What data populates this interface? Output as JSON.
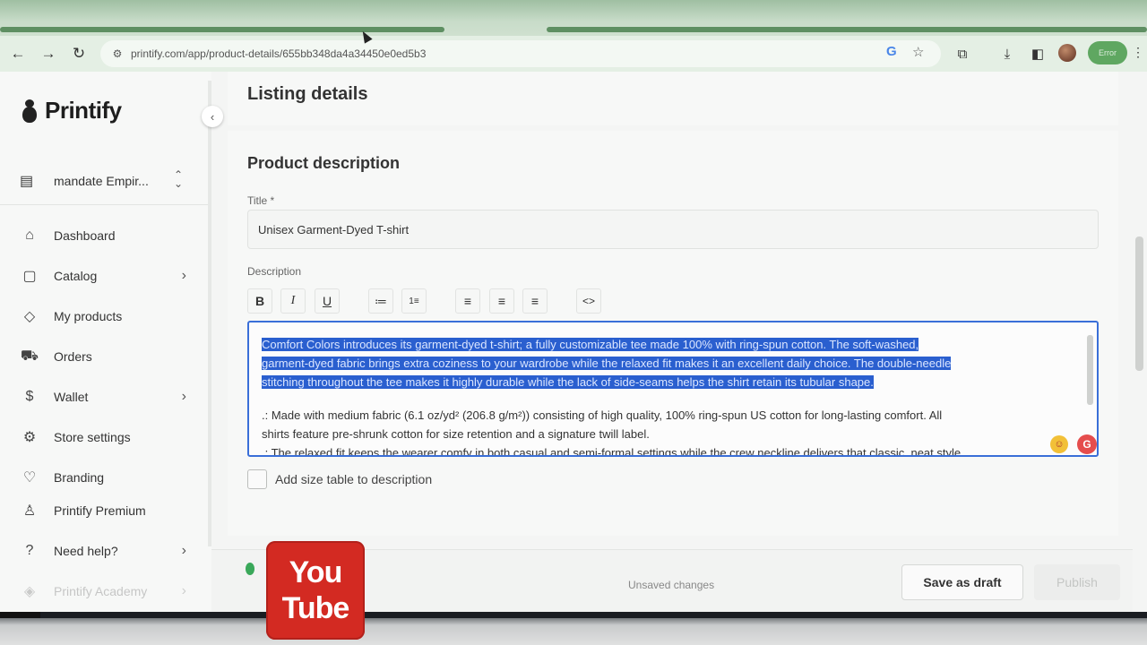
{
  "browser": {
    "url": "printify.com/app/product-details/655bb348da4a34450e0ed5b3",
    "profile_chip": "Error",
    "icons": [
      "back-icon",
      "forward-icon",
      "reload-icon",
      "site-info-icon",
      "google-icon",
      "star-icon",
      "extensions-icon",
      "download-icon",
      "sidepanel-icon",
      "menu-icon"
    ]
  },
  "sidebar": {
    "brand": "Printify",
    "store": "mandate Empir...",
    "items": [
      {
        "label": "Dashboard",
        "icon": "home-icon",
        "chevron": false
      },
      {
        "label": "Catalog",
        "icon": "catalog-icon",
        "chevron": true
      },
      {
        "label": "My products",
        "icon": "tag-icon",
        "chevron": false
      },
      {
        "label": "Orders",
        "icon": "truck-icon",
        "chevron": false
      },
      {
        "label": "Wallet",
        "icon": "dollar-icon",
        "chevron": true
      },
      {
        "label": "Store settings",
        "icon": "gear-icon",
        "chevron": false
      },
      {
        "label": "Branding",
        "icon": "heart-icon",
        "chevron": false
      },
      {
        "label": "Printify Premium",
        "icon": "premium-icon",
        "chevron": false
      },
      {
        "label": "Need help?",
        "icon": "help-icon",
        "chevron": true
      },
      {
        "label": "Printify Academy",
        "icon": "academy-icon",
        "chevron": true
      }
    ]
  },
  "main": {
    "listing_title": "Listing details",
    "section_title": "Product description",
    "title_label": "Title *",
    "title_value": "Unisex Garment-Dyed T-shirt",
    "description_label": "Description",
    "toolbar": [
      "B",
      "I",
      "U",
      "≔",
      "1≡",
      "≡",
      "≡",
      "≡",
      "<>"
    ],
    "description": {
      "line1": "Comfort Colors introduces its garment-dyed t-shirt; a fully customizable tee made 100% with ring-spun cotton. The soft-washed,",
      "line2": "garment-dyed fabric brings extra coziness to your wardrobe while the relaxed fit makes it an excellent daily choice. The double-needle",
      "line3": "stitching throughout the tee makes it highly durable while the lack of side-seams helps the shirt retain its tubular shape.",
      "line4": ".: Made with medium fabric (6.1 oz/yd² (206.8 g/m²)) consisting of high quality, 100% ring-spun US cotton for long-lasting comfort. All",
      "line5": "shirts feature pre-shrunk cotton for size retention and a signature twill label.",
      "line6": ".: The relaxed fit keeps the wearer comfy in both casual and semi-formal settings while the crew neckline delivers that classic, neat style"
    },
    "size_table_label": "Add size table to description"
  },
  "footer": {
    "status": "Unsaved changes",
    "save_draft": "Save as draft",
    "publish": "Publish"
  },
  "overlay": {
    "yt_line1": "You",
    "yt_line2": "Tube"
  },
  "colors": {
    "selection": "#2a5fcf",
    "focus_border": "#3a6fd8",
    "youtube_red": "#d32a22",
    "browser_theme": "#e4efe4"
  }
}
